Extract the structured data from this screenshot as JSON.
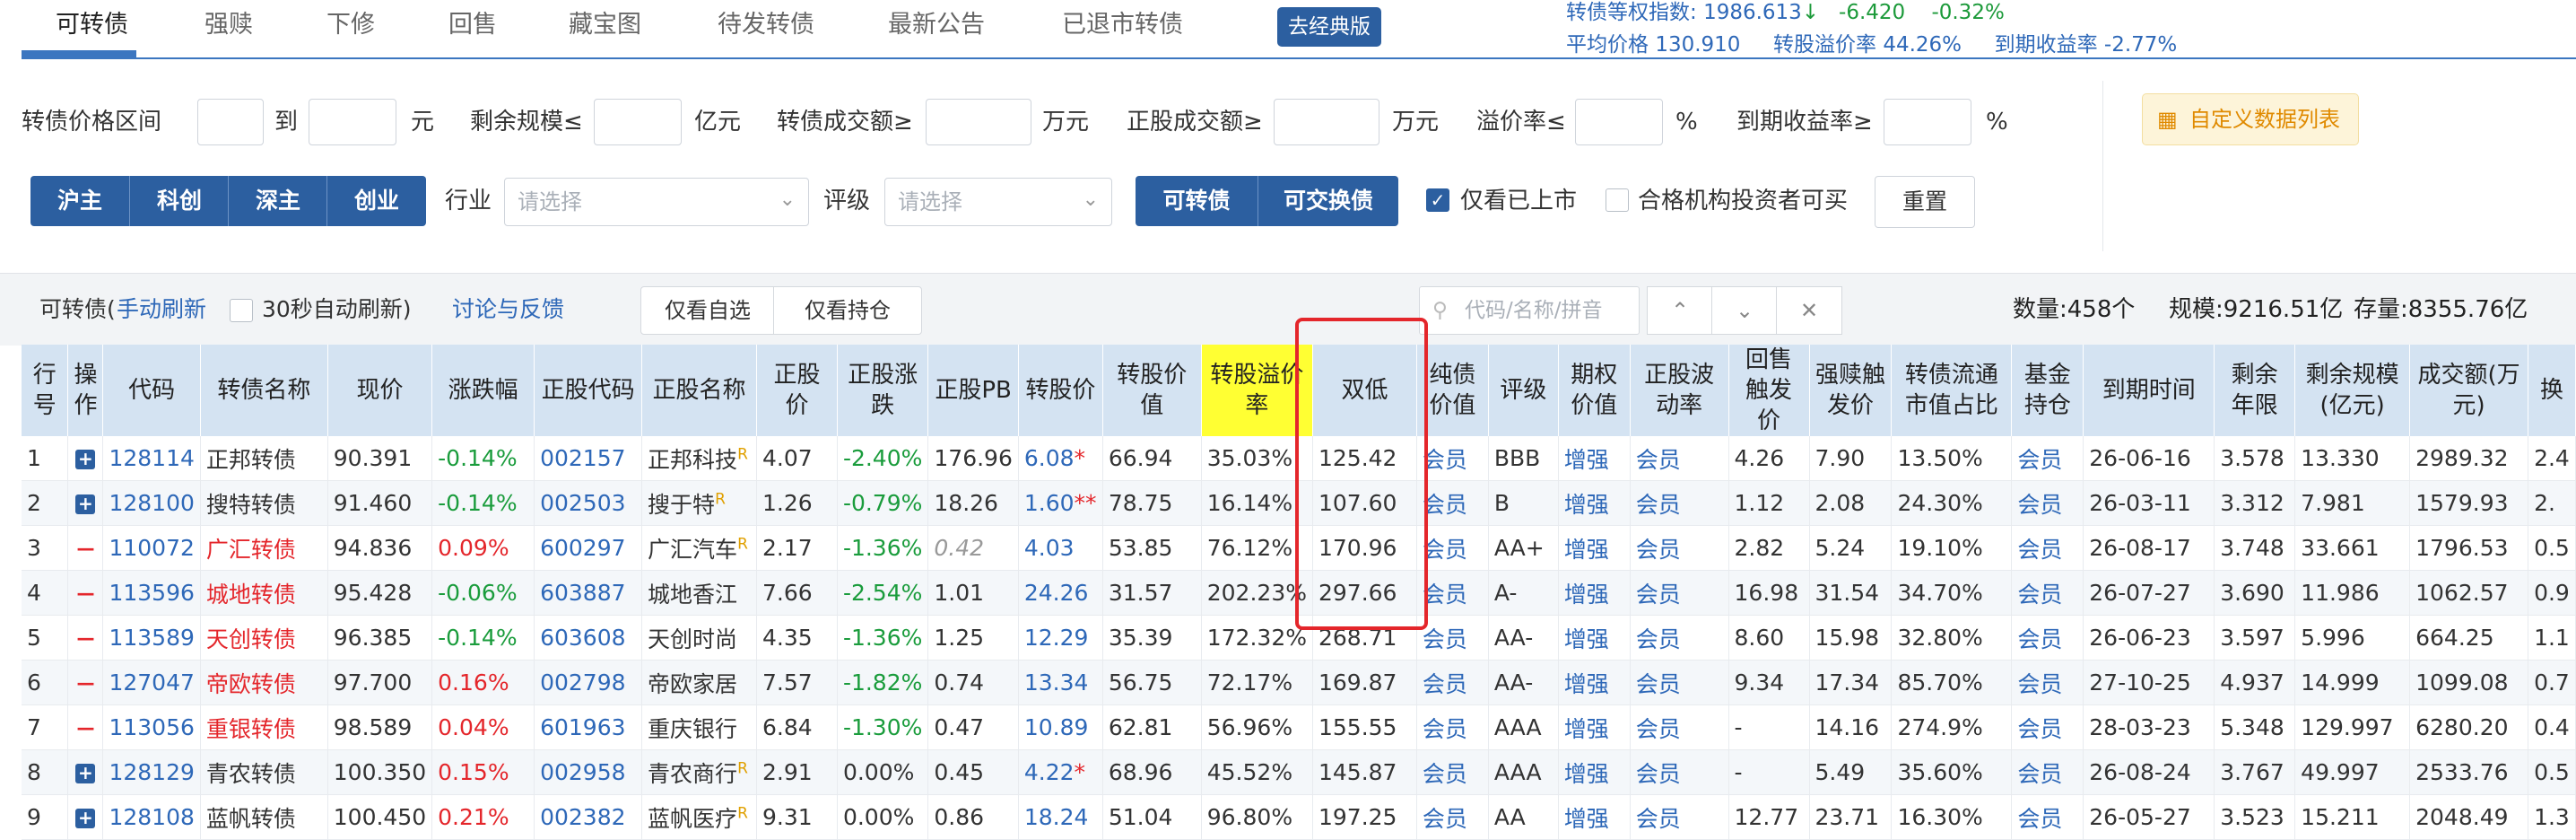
{
  "tabs": [
    "可转债",
    "强赎",
    "下修",
    "回售",
    "藏宝图",
    "待发转债",
    "最新公告",
    "已退市转债"
  ],
  "classic_button": "去经典版",
  "index": {
    "line1_label": "转债等权指数:",
    "line1_value": "1986.613",
    "line1_arrow": "↓",
    "line1_change": "-6.420",
    "line1_pct": "-0.32%",
    "avg_price_label": "平均价格",
    "avg_price": "130.910",
    "premium_label": "转股溢价率",
    "premium": "44.26%",
    "ytm_label": "到期收益率",
    "ytm": "-2.77%"
  },
  "filters": {
    "price_range_label": "转债价格区间",
    "to_label": "到",
    "yuan": "元",
    "remaining_label": "剩余规模≤",
    "yiyuan": "亿元",
    "cb_turnover_label": "转债成交额≥",
    "wanyuan1": "万元",
    "stock_turnover_label": "正股成交额≥",
    "wanyuan2": "万元",
    "premium_label": "溢价率≤",
    "pct1": "%",
    "ytm_label": "到期收益率≥",
    "pct2": "%",
    "custom_list_icon": "grid-icon",
    "custom_list": "自定义数据列表",
    "markets": [
      "沪主",
      "科创",
      "深主",
      "创业"
    ],
    "industry_label": "行业",
    "industry_placeholder": "请选择",
    "rating_label": "评级",
    "rating_placeholder": "请选择",
    "bond_types": [
      "可转债",
      "可交换债"
    ],
    "listed_only": "仅看已上市",
    "qualified_only": "合格机构投资者可买",
    "reset": "重置"
  },
  "toolbar": {
    "title": "可转债(",
    "manual_refresh": "手动刷新",
    "auto_refresh": "30秒自动刷新)",
    "feedback": "讨论与反馈",
    "watch_only": "仅看自选",
    "hold_only": "仅看持仓",
    "search_placeholder": "代码/名称/拼音",
    "count": "数量:458个",
    "scale": "规模:9216.51亿",
    "stock": "存量:8355.76亿"
  },
  "table": {
    "headers": [
      "行号",
      "操作",
      "代码",
      "转债名称",
      "现价",
      "涨跌幅",
      "正股代码",
      "正股名称",
      "正股价",
      "正股涨跌",
      "正股PB",
      "转股价",
      "转股价值",
      "转股溢价率",
      "双低",
      "纯债价值",
      "评级",
      "期权价值",
      "正股波动率",
      "回售触发价",
      "强赎触发价",
      "转债流通市值占比",
      "基金持仓",
      "到期时间",
      "剩余年限",
      "剩余规模(亿元)",
      "成交额(万元)",
      "换"
    ],
    "rows": [
      {
        "no": "1",
        "op": "+",
        "code": "128114",
        "name": "正邦转债",
        "price": "90.391",
        "chg": "-0.14%",
        "scode": "002157",
        "sname": "正邦科技",
        "sprice": "4.07",
        "schg": "-2.40%",
        "pb": "176.96",
        "cprice": "6.08",
        "cstar": "*",
        "cvalue": "66.94",
        "prem": "35.03%",
        "dual": "125.42",
        "pure": "会员",
        "rating": "BBB",
        "opt": "增强",
        "vol": "会员",
        "put": "4.26",
        "call": "7.90",
        "ratio": "13.50%",
        "fund": "会员",
        "mature": "26-06-16",
        "years": "3.578",
        "remain": "13.330",
        "amount": "2989.32",
        "last": "2.4"
      },
      {
        "no": "2",
        "op": "+",
        "code": "128100",
        "name": "搜特转债",
        "price": "91.460",
        "chg": "-0.14%",
        "scode": "002503",
        "sname": "搜于特",
        "sprice": "1.26",
        "schg": "-0.79%",
        "pb": "18.26",
        "cprice": "1.60",
        "cstar": "**",
        "cvalue": "78.75",
        "prem": "16.14%",
        "dual": "107.60",
        "pure": "会员",
        "rating": "B",
        "opt": "增强",
        "vol": "会员",
        "put": "1.12",
        "call": "2.08",
        "ratio": "24.30%",
        "fund": "会员",
        "mature": "26-03-11",
        "years": "3.312",
        "remain": "7.981",
        "amount": "1579.93",
        "last": "2."
      },
      {
        "no": "3",
        "op": "-",
        "code": "110072",
        "name": "广汇转债",
        "price": "94.836",
        "chg": "0.09%",
        "scode": "600297",
        "sname": "广汇汽车",
        "sprice": "2.17",
        "schg": "-1.36%",
        "pb": "0.42",
        "cprice": "4.03",
        "cstar": "",
        "cvalue": "53.85",
        "prem": "76.12%",
        "dual": "170.96",
        "pure": "会员",
        "rating": "AA+",
        "opt": "增强",
        "vol": "会员",
        "put": "2.82",
        "call": "5.24",
        "ratio": "19.10%",
        "fund": "会员",
        "mature": "26-08-17",
        "years": "3.748",
        "remain": "33.661",
        "amount": "1796.53",
        "last": "0.5"
      },
      {
        "no": "4",
        "op": "-",
        "code": "113596",
        "name": "城地转债",
        "price": "95.428",
        "chg": "-0.06%",
        "scode": "603887",
        "sname": "城地香江",
        "sprice": "7.66",
        "schg": "-2.54%",
        "pb": "1.01",
        "cprice": "24.26",
        "cstar": "",
        "cvalue": "31.57",
        "prem": "202.23%",
        "dual": "297.66",
        "pure": "会员",
        "rating": "A-",
        "opt": "增强",
        "vol": "会员",
        "put": "16.98",
        "call": "31.54",
        "ratio": "34.70%",
        "fund": "会员",
        "mature": "26-07-27",
        "years": "3.690",
        "remain": "11.986",
        "amount": "1062.57",
        "last": "0.9"
      },
      {
        "no": "5",
        "op": "-",
        "code": "113589",
        "name": "天创转债",
        "price": "96.385",
        "chg": "-0.14%",
        "scode": "603608",
        "sname": "天创时尚",
        "sprice": "4.35",
        "schg": "-1.36%",
        "pb": "1.25",
        "cprice": "12.29",
        "cstar": "",
        "cvalue": "35.39",
        "prem": "172.32%",
        "dual": "268.71",
        "pure": "会员",
        "rating": "AA-",
        "opt": "增强",
        "vol": "会员",
        "put": "8.60",
        "call": "15.98",
        "ratio": "32.80%",
        "fund": "会员",
        "mature": "26-06-23",
        "years": "3.597",
        "remain": "5.996",
        "amount": "664.25",
        "last": "1.1"
      },
      {
        "no": "6",
        "op": "-",
        "code": "127047",
        "name": "帝欧转债",
        "price": "97.700",
        "chg": "0.16%",
        "scode": "002798",
        "sname": "帝欧家居",
        "sprice": "7.57",
        "schg": "-1.82%",
        "pb": "0.74",
        "cprice": "13.34",
        "cstar": "",
        "cvalue": "56.75",
        "prem": "72.17%",
        "dual": "169.87",
        "pure": "会员",
        "rating": "AA-",
        "opt": "增强",
        "vol": "会员",
        "put": "9.34",
        "call": "17.34",
        "ratio": "85.70%",
        "fund": "会员",
        "mature": "27-10-25",
        "years": "4.937",
        "remain": "14.999",
        "amount": "1099.08",
        "last": "0.7"
      },
      {
        "no": "7",
        "op": "-",
        "code": "113056",
        "name": "重银转债",
        "price": "98.589",
        "chg": "0.04%",
        "scode": "601963",
        "sname": "重庆银行",
        "sprice": "6.84",
        "schg": "-1.30%",
        "pb": "0.47",
        "cprice": "10.89",
        "cstar": "",
        "cvalue": "62.81",
        "prem": "56.96%",
        "dual": "155.55",
        "pure": "会员",
        "rating": "AAA",
        "opt": "增强",
        "vol": "会员",
        "put": "-",
        "call": "14.16",
        "ratio": "274.9%",
        "fund": "会员",
        "mature": "28-03-23",
        "years": "5.348",
        "remain": "129.997",
        "amount": "6280.20",
        "last": "0.4"
      },
      {
        "no": "8",
        "op": "+",
        "code": "128129",
        "name": "青农转债",
        "price": "100.350",
        "chg": "0.15%",
        "scode": "002958",
        "sname": "青农商行",
        "sprice": "2.91",
        "schg": "0.00%",
        "pb": "0.45",
        "cprice": "4.22",
        "cstar": "*",
        "cvalue": "68.96",
        "prem": "45.52%",
        "dual": "145.87",
        "pure": "会员",
        "rating": "AAA",
        "opt": "增强",
        "vol": "会员",
        "put": "-",
        "call": "5.49",
        "ratio": "35.60%",
        "fund": "会员",
        "mature": "26-08-24",
        "years": "3.767",
        "remain": "49.997",
        "amount": "2533.76",
        "last": "0.5"
      },
      {
        "no": "9",
        "op": "+",
        "code": "128108",
        "name": "蓝帆转债",
        "price": "100.450",
        "chg": "0.21%",
        "scode": "002382",
        "sname": "蓝帆医疗",
        "sprice": "9.31",
        "schg": "0.00%",
        "pb": "0.86",
        "cprice": "18.24",
        "cstar": "",
        "cvalue": "51.04",
        "prem": "96.80%",
        "dual": "197.25",
        "pure": "会员",
        "rating": "AA",
        "opt": "增强",
        "vol": "会员",
        "put": "12.77",
        "call": "23.71",
        "ratio": "16.30%",
        "fund": "会员",
        "mature": "26-05-27",
        "years": "3.523",
        "remain": "15.211",
        "amount": "2048.49",
        "last": "1.3"
      }
    ]
  },
  "colors": {
    "accent": "#2c5fa0",
    "up": "#e4262b",
    "down": "#1a9c3c",
    "header_bg": "#d4e3f2",
    "highlight": "#ffff33"
  }
}
